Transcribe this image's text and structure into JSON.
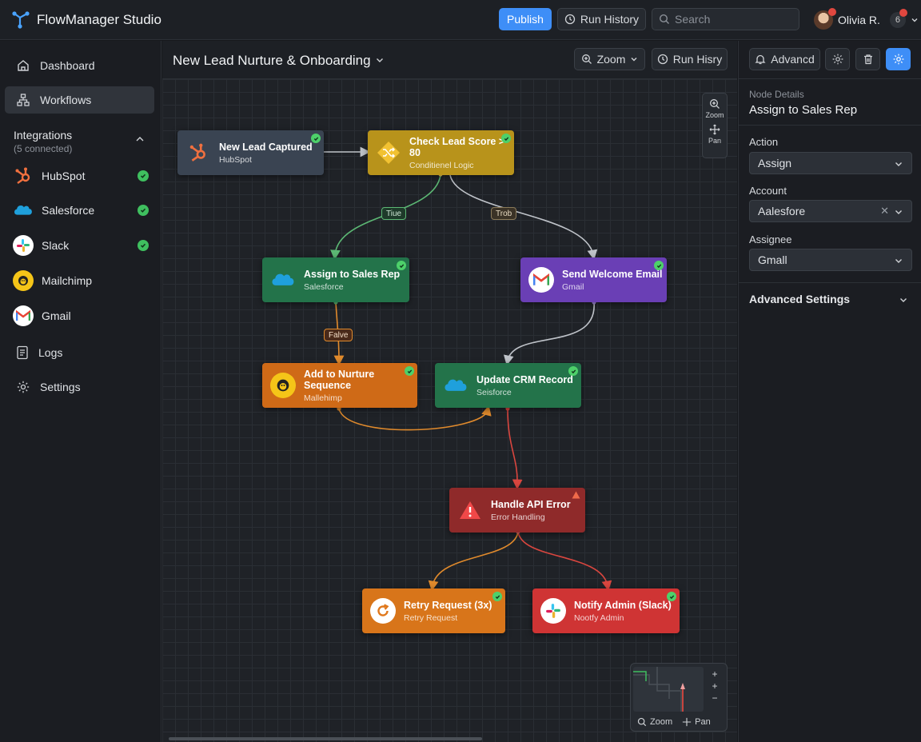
{
  "app": {
    "name": "FlowManager Studio"
  },
  "topbar": {
    "publish_label": "Publish",
    "run_history_label": "Run History",
    "search_placeholder": "Search",
    "user_name": "Olivia R.",
    "notif_count": "6"
  },
  "sidebar": {
    "nav": [
      {
        "label": "Dashboard",
        "icon": "home-icon"
      },
      {
        "label": "Workflows",
        "icon": "workflow-icon",
        "active": true
      }
    ],
    "integrations_title": "Integrations",
    "integrations_sub": "(5 connected)",
    "integrations": [
      {
        "label": "HubSpot",
        "icon": "hubspot-icon",
        "connected": true
      },
      {
        "label": "Salesforce",
        "icon": "salesforce-icon",
        "connected": true
      },
      {
        "label": "Slack",
        "icon": "slack-icon",
        "connected": true
      },
      {
        "label": "Mailchimp",
        "icon": "mailchimp-icon",
        "connected": false
      },
      {
        "label": "Gmail",
        "icon": "gmail-icon",
        "connected": false
      }
    ],
    "bottom_nav": [
      {
        "label": "Logs",
        "icon": "logs-icon"
      },
      {
        "label": "Settings",
        "icon": "gear-icon"
      }
    ]
  },
  "canvas": {
    "workflow_title": "New Lead Nurture & Onboarding",
    "zoom_label": "Zoom",
    "run_history_label": "Run Hisry",
    "tool_zoom": "Zoom",
    "tool_pan": "Pan",
    "nodes": [
      {
        "id": "lead",
        "title": "New Lead Captured",
        "sub": "HubSpot",
        "color": "#3a4452",
        "icon": "hubspot-icon",
        "status": "ok"
      },
      {
        "id": "score",
        "title": "Check Lead Score > 80",
        "sub": "Conditienel Logic",
        "color": "#b8931b",
        "icon": "shuffle-icon",
        "status": "ok"
      },
      {
        "id": "assign",
        "title": "Assign to Sales Rep",
        "sub": "Salesforce",
        "color": "#23734a",
        "icon": "salesforce-icon",
        "status": "ok"
      },
      {
        "id": "welcome",
        "title": "Send Welcome Email",
        "sub": "Gmail",
        "color": "#6a3fb5",
        "icon": "gmail-icon",
        "status": "ok"
      },
      {
        "id": "nurture",
        "title": "Add to Nurture Sequence",
        "sub": "Mallehimp",
        "color": "#cf6a17",
        "icon": "mailchimp-icon",
        "status": "ok"
      },
      {
        "id": "crm",
        "title": "Update CRM Record",
        "sub": "Seisforce",
        "color": "#23734a",
        "icon": "salesforce-icon",
        "status": "ok"
      },
      {
        "id": "error",
        "title": "Handle API Error",
        "sub": "Error Handling",
        "color": "#8f2a2a",
        "icon": "warning-icon",
        "status": "warn"
      },
      {
        "id": "retry",
        "title": "Retry Request (3x)",
        "sub": "Retry Request",
        "color": "#d8751a",
        "icon": "retry-icon",
        "status": "ok"
      },
      {
        "id": "notify",
        "title": "Notify Admin (Slack)",
        "sub": "Nootfy Admin",
        "color": "#cf3434",
        "icon": "slack-icon",
        "status": "ok"
      }
    ],
    "edge_labels": {
      "true": "Tiue",
      "false_right": "Trob",
      "false_mid": "Falve"
    },
    "minimap": {
      "zoom": "Zoom",
      "pan": "Pan"
    }
  },
  "panel": {
    "advanced_label": "Advancd",
    "node_details_label": "Node Details",
    "node_title": "Assign to Sales Rep",
    "action_label": "Action",
    "action_value": "Assign",
    "account_label": "Account",
    "account_value": "Aalesfore",
    "assignee_label": "Assignee",
    "assignee_value": "Gmall",
    "advanced_settings": "Advanced Settings"
  },
  "colors": {
    "accent": "#3e8ef7",
    "success": "#3fbf5f",
    "error": "#e0473f"
  }
}
